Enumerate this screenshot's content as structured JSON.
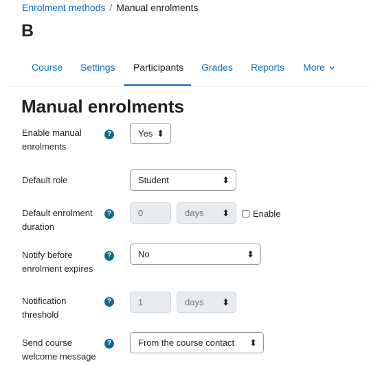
{
  "breadcrumb": {
    "link": "Enrolment methods",
    "separator": "/",
    "current": "Manual enrolments"
  },
  "course_title": "B",
  "tabs": [
    {
      "label": "Course"
    },
    {
      "label": "Settings"
    },
    {
      "label": "Participants"
    },
    {
      "label": "Grades"
    },
    {
      "label": "Reports"
    },
    {
      "label": "More",
      "icon": "chevron-down-icon"
    }
  ],
  "active_tab": "Participants",
  "page_title": "Manual enrolments",
  "form": {
    "enable": {
      "label": "Enable manual enrolments",
      "value": "Yes"
    },
    "default_role": {
      "label": "Default role",
      "value": "Student"
    },
    "duration": {
      "label": "Default enrolment duration",
      "number": "0",
      "unit": "days",
      "checkbox_label": "Enable",
      "checked": false
    },
    "notify": {
      "label": "Notify before enrolment expires",
      "value": "No"
    },
    "threshold": {
      "label": "Notification threshold",
      "number": "1",
      "unit": "days"
    },
    "welcome": {
      "label": "Send course welcome message",
      "value": "From the course contact"
    }
  },
  "help_glyph": "?",
  "colors": {
    "link": "#0f6cbf",
    "help_badge": "#0f6c8a",
    "text": "#1d2125"
  }
}
